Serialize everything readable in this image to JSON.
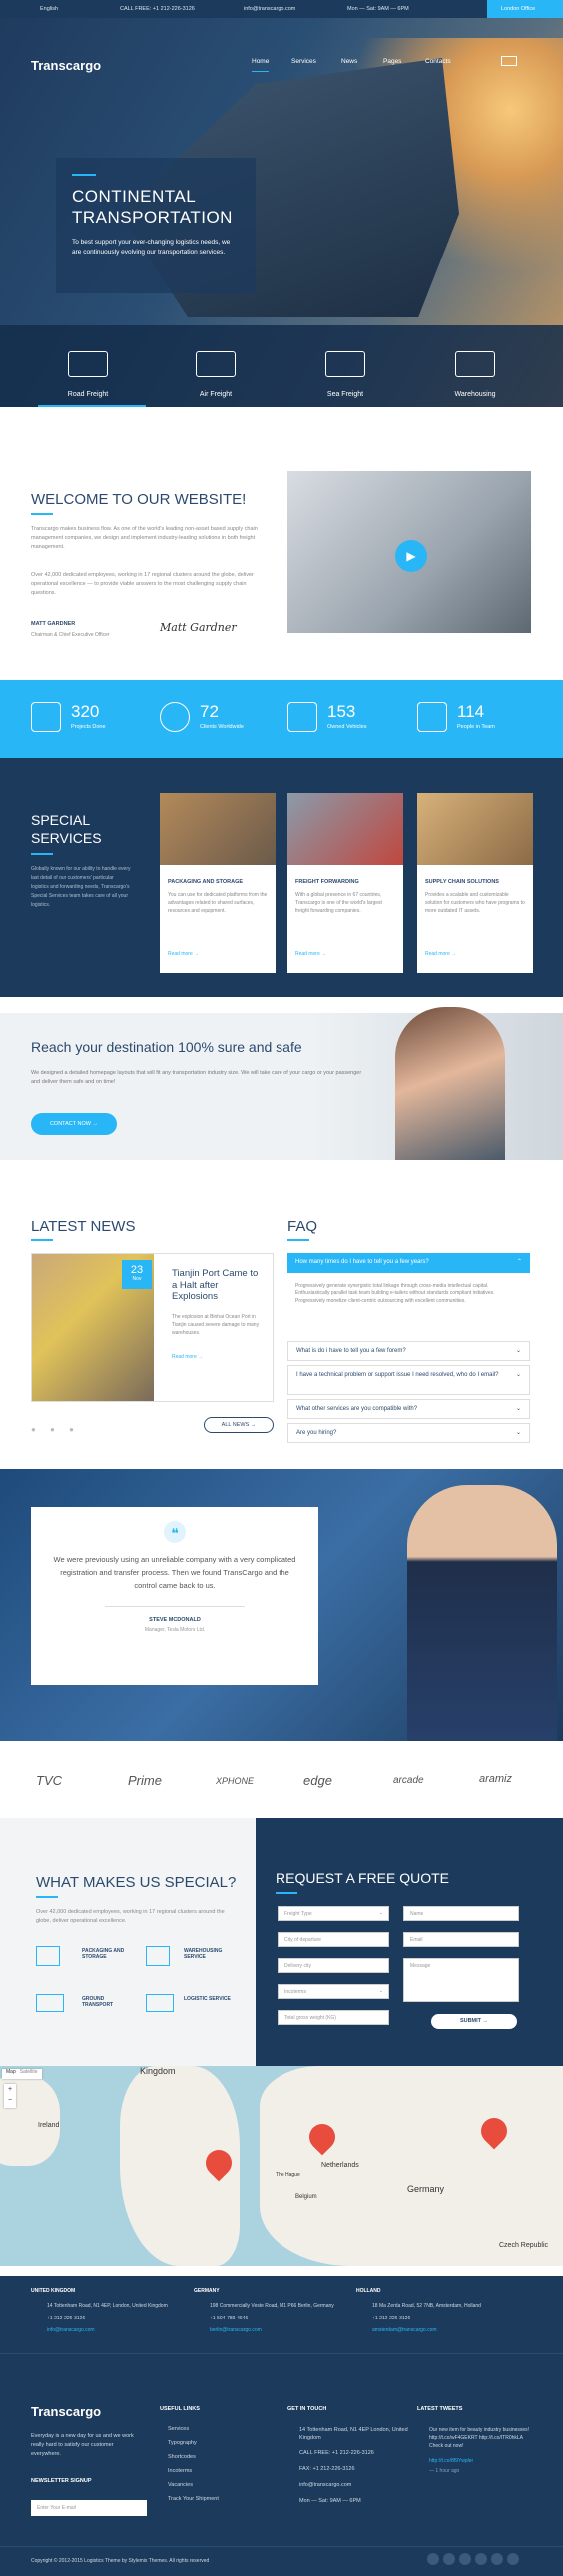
{
  "topbar": {
    "language": "English",
    "phone": "CALL FREE: +1 212-226-3126",
    "email": "info@transcargo.com",
    "hours": "Mon — Sat: 9AM — 6PM",
    "location": "London Office"
  },
  "header": {
    "logo": "Transcargo",
    "nav": [
      "Home",
      "Services",
      "News",
      "Pages",
      "Contacts"
    ]
  },
  "hero": {
    "title_line1": "CONTINENTAL",
    "title_line2": "TRANSPORTATION",
    "text": "To best support your ever-changing logistics needs, we are continuously evolving our transportation services.",
    "features": [
      "Road Freight",
      "Air Freight",
      "Sea Freight",
      "Warehousing"
    ]
  },
  "welcome": {
    "title": "WELCOME TO OUR WEBSITE!",
    "p1": "Transcargo makes business flow. As one of the world's leading non-asset based supply chain management companies, we design and implement industry-leading solutions in both freight management.",
    "p2": "Over 42,000 dedicated employees, working in 17 regional clusters around the globe, deliver operational excellence — to provide viable answers to the most challenging supply chain questions.",
    "name": "MATT GARDNER",
    "role": "Chairman & Chief Executive Officer",
    "signature": "Matt Gardner"
  },
  "stats": [
    {
      "value": "320",
      "label": "Projects Done"
    },
    {
      "value": "72",
      "label": "Clients Worldwide"
    },
    {
      "value": "153",
      "label": "Owned Vehicles"
    },
    {
      "value": "114",
      "label": "People in Team"
    }
  ],
  "services": {
    "title_line1": "SPECIAL",
    "title_line2": "SERVICES",
    "text": "Globally known for our ability to handle every last detail of our customers' particular logistics and forwarding needs, Transcargo's Special Services team takes care of all your logistics.",
    "read_more": "Read more →",
    "cards": [
      {
        "title": "PACKAGING AND STORAGE",
        "text": "You can use for dedicated platforms from the advantages related to shared surfaces, resources and equipment."
      },
      {
        "title": "FREIGHT FORWARDING",
        "text": "With a global presence in 67 countries, Transcargo is one of the world's largest freight forwarding companies."
      },
      {
        "title": "SUPPLY CHAIN SOLUTIONS",
        "text": "Provides a scalable and customizable solution for customers who have programs to more outdated IT assets."
      }
    ]
  },
  "reach": {
    "title": "Reach your destination 100% sure and safe",
    "text": "We designed a detailed homepage layouts that will fit any transportation industry size. We will take care of your cargo or your passenger and deliver them safe and on time!",
    "button": "CONTACT NOW"
  },
  "news": {
    "title": "LATEST NEWS",
    "day": "23",
    "month": "Nov",
    "headline": "Tianjin Port Came to a Halt after Explosions",
    "text": "The explosion at Binhai Ocean Port in Tianjin caused severe damage to many warehouses.",
    "read_more": "Read more →",
    "all_news": "ALL NEWS"
  },
  "faq": {
    "title": "FAQ",
    "active_q": "How many times do I have to tell you a few years?",
    "active_a": "Progressively generate synergistic total linkage through cross-media intellectual capital. Enthusiastically parallel task team building e-tailers without standards compliant initiatives. Progressively monetize client-centric outsourcing with excellent communities.",
    "questions": [
      "What is do i have to tell you a few forem?",
      "I have a technical problem or support issue I need resolved, who do I email?",
      "What other services are you compatible with?",
      "Are you hiring?"
    ]
  },
  "testimonial": {
    "text": "We were previously using an unreliable company with a very complicated registration and transfer process. Then we found TransCargo and the control came back to us.",
    "name": "STEVE MCDONALD",
    "role": "Manager, Tesla Motors Ltd."
  },
  "partners": [
    "TVC",
    "Prime",
    "XPHONE",
    "edge",
    "arcade",
    "aramiz"
  ],
  "special": {
    "title": "WHAT MAKES US SPECIAL?",
    "text": "Over 42,000 dedicated employees, working in 17 regional clusters around the globe, deliver operational excellence.",
    "items": [
      "PACKAGING AND STORAGE",
      "WAREHOUSING SERVICE",
      "GROUND TRANSPORT",
      "LOGISTIC SERVICE"
    ]
  },
  "quote": {
    "title": "REQUEST A FREE QUOTE",
    "freight_type": "Freight Type",
    "departure": "City of departure",
    "delivery": "Delivery city",
    "incoterms": "Incoterms",
    "weight": "Total gross weight (KG)",
    "name": "Name",
    "email": "Email",
    "message": "Message",
    "submit": "SUBMIT"
  },
  "map": {
    "tabs": [
      "Map",
      "Satellite"
    ],
    "labels": [
      "Kingdom",
      "Ireland",
      "Netherlands",
      "Belgium",
      "Germany",
      "Czech Republic",
      "The Hague"
    ]
  },
  "offices": [
    {
      "country": "UNITED KINGDOM",
      "address": "14 Tottenham Road, N1 4EP, London, United Kingdom",
      "phone": "+1 212-226-3126",
      "email": "info@transcargo.com"
    },
    {
      "country": "GERMANY",
      "address": "198 Commercially Veste Road, M1 P66 Berlin, Germany",
      "phone": "+1 504-789-4646",
      "email": "berlin@transcargo.com"
    },
    {
      "country": "HOLLAND",
      "address": "18 Ma Zerda Road, 52 7NB, Amsterdam, Holland",
      "phone": "+1 212-226-3126",
      "email": "amsterdam@transcargo.com"
    }
  ],
  "footer": {
    "logo": "Transcargo",
    "about": "Everyday is a new day for us and we work really hard to satisfy our customer everywhere.",
    "newsletter": "NEWSLETTER SIGNUP",
    "newsletter_placeholder": "Enter Your E-mail",
    "links_title": "USEFUL LINKS",
    "links": [
      "Services",
      "Typography",
      "Shortcodes",
      "Incoterms",
      "Vacancies",
      "Track Your Shipment"
    ],
    "contact_title": "GET IN TOUCH",
    "contact_address": "14 Tottenham Road, N1 4EP London, United Kingdom",
    "contact_phone": "CALL FREE: +1 212-226-3126",
    "contact_fax": "FAX: +1 212-226-3126",
    "contact_email": "info@transcargo.com",
    "contact_hours": "Mon — Sat: 9AM — 6PM",
    "tweets_title": "LATEST TWEETS",
    "tweet": "Our new item for beauty industry businesses! http://t.co/wF4GEKRT http://t.co/ITR0hkLA Check out now!",
    "tweet_link": "http://t.co/8f9Ywpler",
    "tweet_time": "— 1 hour ago",
    "copyright": "Copyright © 2012-2015 Logistics Theme by Stylemix Themes. All rights reserved"
  },
  "colors": {
    "navy": "#1c3a5c",
    "accent": "#29b6f6"
  }
}
